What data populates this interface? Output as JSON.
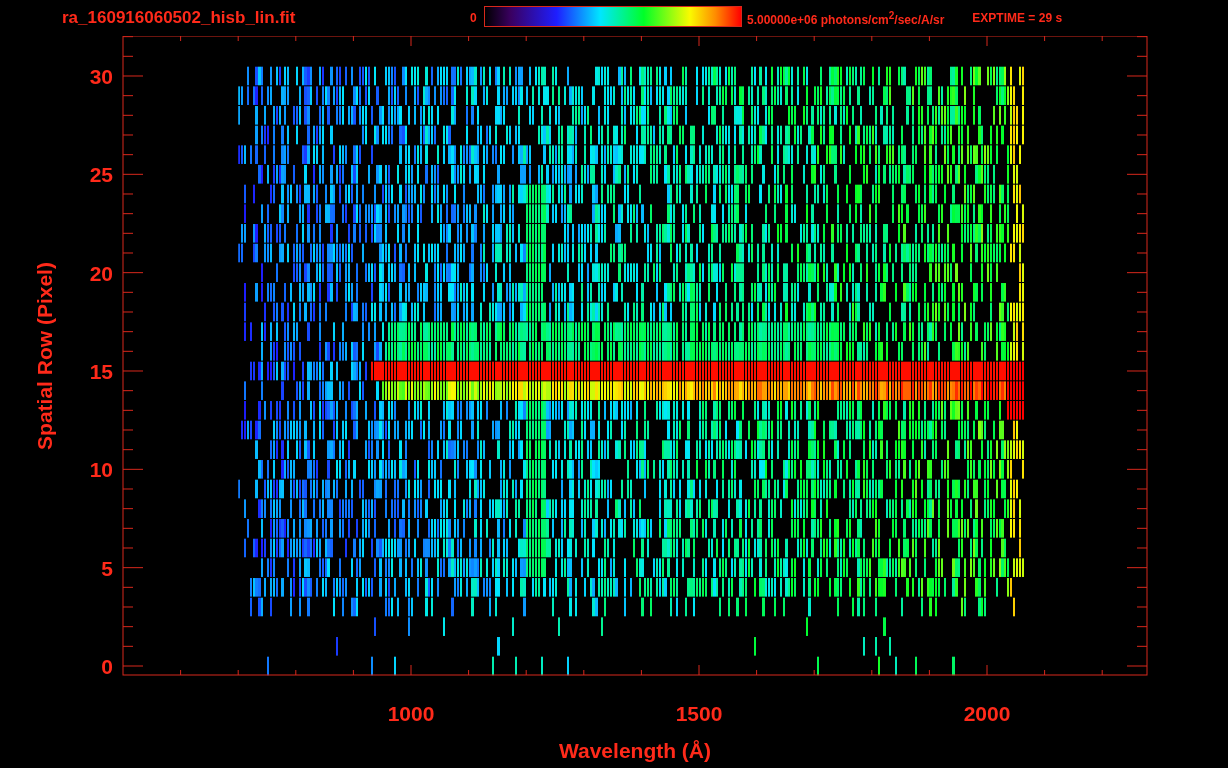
{
  "title": "ra_160916060502_hisb_lin.fit",
  "colorbar": {
    "min_label": "0",
    "max_label": "5.00000e+06 photons/cm$^{2}$/sec/A/sr"
  },
  "exposure": "EXPTIME = 29 s",
  "plot": {
    "xaxis": {
      "title": "Wavelength (Å)",
      "tick_labels": [
        "1000",
        "1500",
        "2000"
      ]
    },
    "yaxis": {
      "title": "Spatial Row (Pixel)",
      "tick_labels": [
        "30",
        "25",
        "20",
        "15",
        "10",
        "5",
        "0"
      ]
    }
  }
}
